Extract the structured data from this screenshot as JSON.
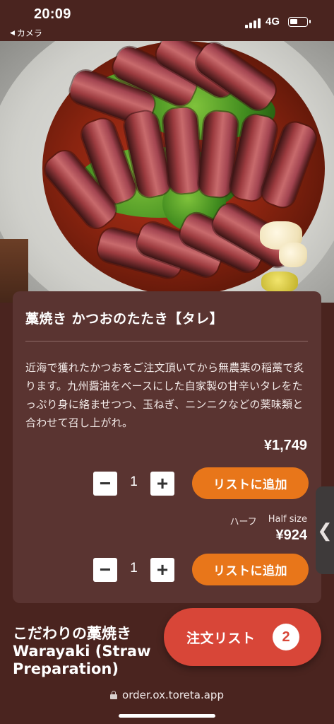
{
  "status_bar": {
    "time": "20:09",
    "back_app": "カメラ",
    "network": "4G",
    "battery_level": 0.45
  },
  "product": {
    "title": "藁焼き かつおのたたき【タレ】",
    "description": "近海で獲れたかつおをご注文頂いてから無農薬の稲藁で炙ります。九州醤油をベースにした自家製の甘辛いタレをたっぷり身に絡ませつつ、玉ねぎ、ニンニクなどの薬味類と合わせて召し上がれ。",
    "full": {
      "price": "¥1,749",
      "quantity": "1",
      "minus_label": "−",
      "plus_label": "+",
      "add_label": "リストに追加"
    },
    "half": {
      "label_ja": "ハーフ",
      "label_en": "Half size",
      "price": "¥924",
      "quantity": "1",
      "minus_label": "−",
      "plus_label": "+",
      "add_label": "リストに追加"
    }
  },
  "side_tab": {
    "glyph": "❮"
  },
  "section": {
    "heading_line1": "こだわりの藁焼き",
    "heading_line2": "Warayaki (Straw",
    "heading_line3": "Preparation)"
  },
  "order_list": {
    "label": "注文リスト",
    "count": "2"
  },
  "browser": {
    "url": "order.ox.toreta.app"
  },
  "colors": {
    "background": "#4a241f",
    "card": "#5a3431",
    "accent_orange": "#e8761a",
    "order_red": "#d84638"
  }
}
